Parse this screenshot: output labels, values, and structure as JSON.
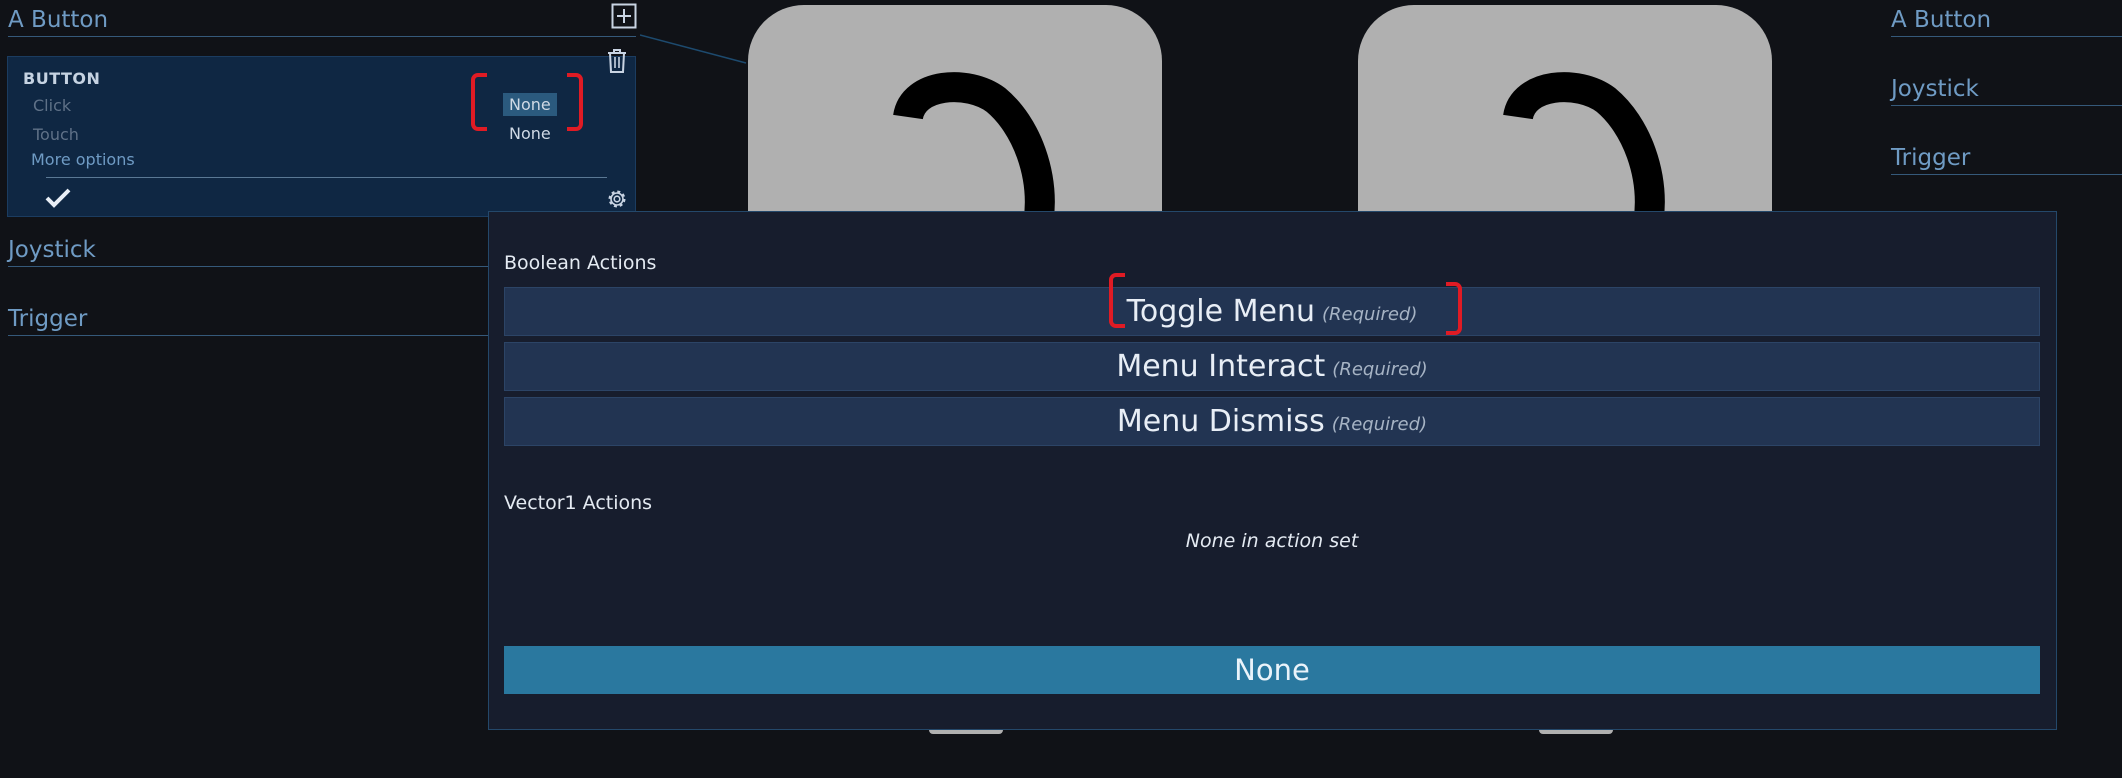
{
  "left_panel": {
    "sections": {
      "a_button": "A Button",
      "joystick": "Joystick",
      "trigger": "Trigger"
    },
    "card": {
      "type": "BUTTON",
      "rows": [
        {
          "label": "Click",
          "value": "None"
        },
        {
          "label": "Touch",
          "value": "None"
        }
      ],
      "more_options": "More options"
    }
  },
  "right_panel": {
    "sections": [
      "A Button",
      "Joystick",
      "Trigger"
    ]
  },
  "popup": {
    "boolean_title": "Boolean Actions",
    "boolean_actions": [
      {
        "name": "Toggle Menu",
        "req": "(Required)"
      },
      {
        "name": "Menu Interact",
        "req": "(Required)"
      },
      {
        "name": "Menu Dismiss",
        "req": "(Required)"
      }
    ],
    "vector_title": "Vector1 Actions",
    "vector_empty": "None in action set",
    "none_button": "None"
  },
  "icons": {
    "add": "add-box-icon",
    "delete": "trash-icon",
    "confirm": "checkmark-icon",
    "settings": "gear-icon"
  },
  "colors": {
    "background": "#101217",
    "card": "#0f2743",
    "popup": "#171d2d",
    "action_row": "#223452",
    "accent_button": "#2a789f",
    "highlight_red": "#e01b24",
    "section_text": "#6f9bc4"
  }
}
